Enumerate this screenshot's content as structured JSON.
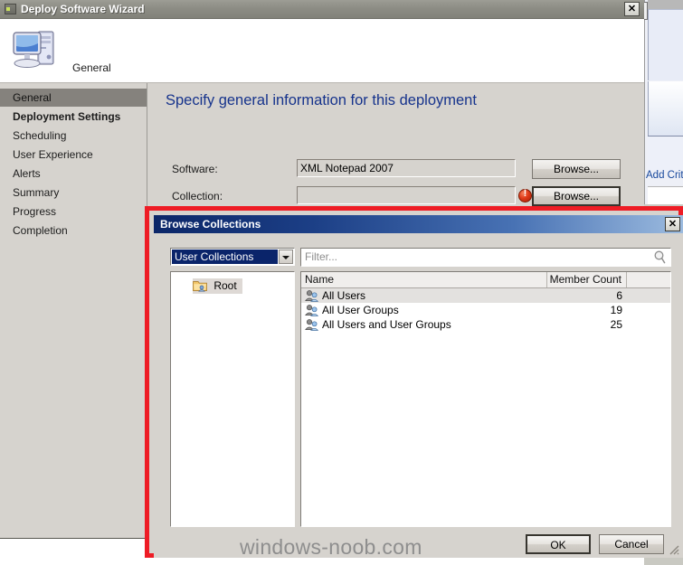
{
  "wizard": {
    "title": "Deploy Software Wizard",
    "close_label": "✕",
    "header_label": "General",
    "header_icon": "computer-icon",
    "sidebar": [
      {
        "label": "General",
        "selected": true,
        "bold": false
      },
      {
        "label": "Deployment Settings",
        "selected": false,
        "bold": true
      },
      {
        "label": "Scheduling",
        "selected": false,
        "bold": false
      },
      {
        "label": "User Experience",
        "selected": false,
        "bold": false
      },
      {
        "label": "Alerts",
        "selected": false,
        "bold": false
      },
      {
        "label": "Summary",
        "selected": false,
        "bold": false
      },
      {
        "label": "Progress",
        "selected": false,
        "bold": false
      },
      {
        "label": "Completion",
        "selected": false,
        "bold": false
      }
    ],
    "content": {
      "heading": "Specify general information for this deployment",
      "software_label": "Software:",
      "software_value": "XML Notepad 2007",
      "software_browse": "Browse...",
      "collection_label": "Collection:",
      "collection_value": "",
      "collection_browse": "Browse...",
      "collection_error_icon": "error-icon"
    }
  },
  "dialog": {
    "title": "Browse Collections",
    "close_label": "✕",
    "highlight_color": "#ee1c25",
    "scope_dropdown": {
      "selected": "User Collections",
      "icon": "chevron-down-icon"
    },
    "filter": {
      "placeholder": "Filter...",
      "value": "",
      "icon": "search-icon"
    },
    "tree": {
      "root_label": "Root",
      "root_icon": "folder-user-icon",
      "selected": true
    },
    "list": {
      "columns": [
        "Name",
        "Member Count"
      ],
      "rows": [
        {
          "name": "All Users",
          "count": "6",
          "icon": "collection-icon",
          "selected": true
        },
        {
          "name": "All User Groups",
          "count": "19",
          "icon": "collection-icon",
          "selected": false
        },
        {
          "name": "All Users and User Groups",
          "count": "25",
          "icon": "collection-icon",
          "selected": false
        }
      ]
    },
    "buttons": {
      "ok": "OK",
      "cancel": "Cancel"
    },
    "resize_grip_icon": "resize-grip-icon"
  },
  "background_window": {
    "link_label": "Add Crite",
    "close_label": "✕"
  },
  "watermark": "windows-noob.com"
}
